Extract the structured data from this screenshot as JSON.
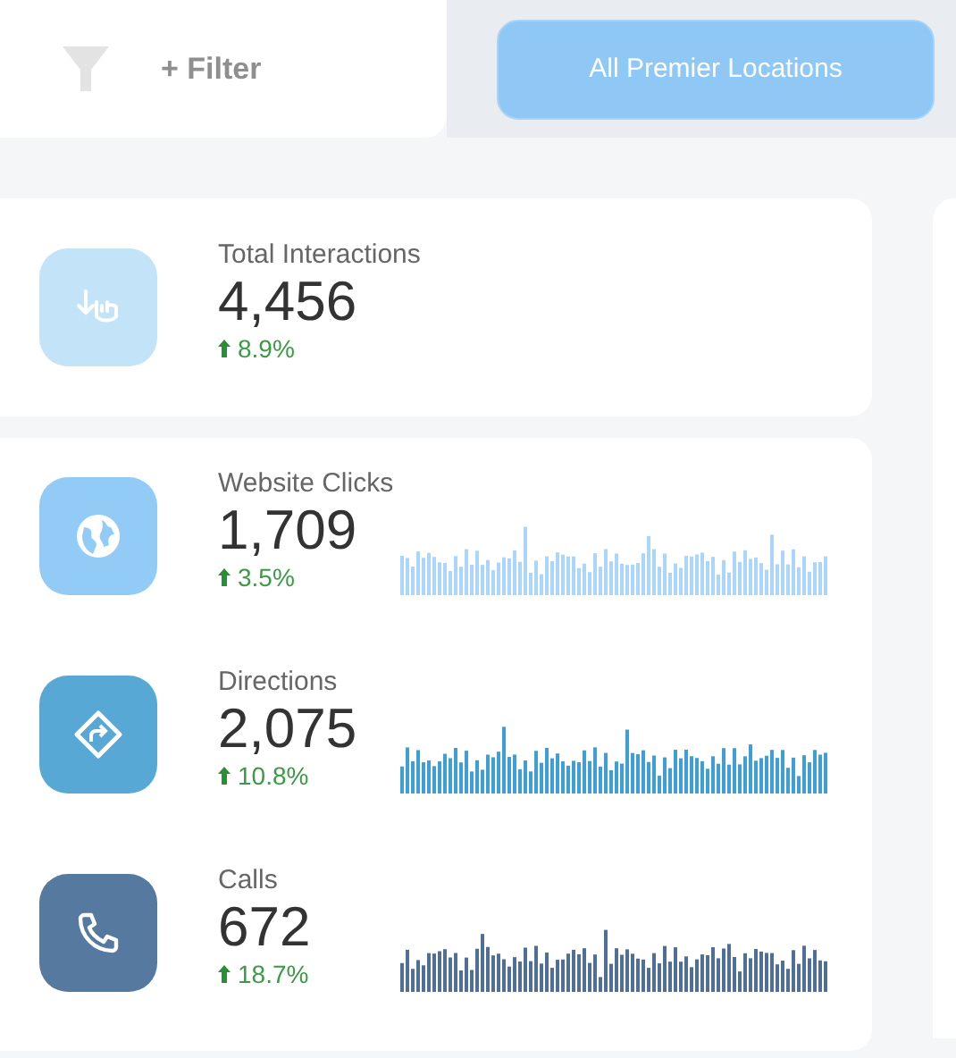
{
  "toolbar": {
    "filter_label": "+ Filter",
    "location_button": "All Premier Locations"
  },
  "summary": {
    "label": "Total Interactions",
    "value": "4,456",
    "change": "8.9%",
    "color": "#c2e3f8"
  },
  "metrics": [
    {
      "label": "Website Clicks",
      "value": "1,709",
      "change": "3.5%",
      "color": "#93cbf7"
    },
    {
      "label": "Directions",
      "value": "2,075",
      "change": "10.8%",
      "color": "#58a8d6"
    },
    {
      "label": "Calls",
      "value": "672",
      "change": "18.7%",
      "color": "#56799f"
    }
  ]
}
